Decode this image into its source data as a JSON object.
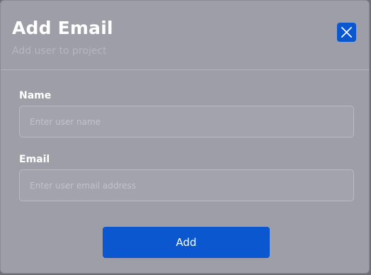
{
  "modal": {
    "title": "Add Email",
    "subtitle": "Add user to project",
    "close_icon": "close-icon"
  },
  "form": {
    "name": {
      "label": "Name",
      "value": "",
      "placeholder": "Enter user name"
    },
    "email": {
      "label": "Email",
      "value": "",
      "placeholder": "Enter user email address"
    },
    "submit_label": "Add"
  },
  "colors": {
    "accent": "#0b57d0",
    "modal_bg": "#9e9ea8"
  }
}
